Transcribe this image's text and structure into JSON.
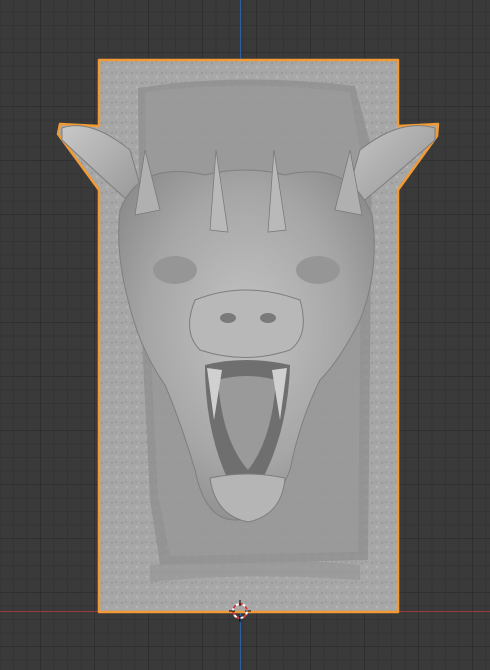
{
  "viewport": {
    "background": "#3a3a3a",
    "grid_color": "#2f2f2f",
    "axis_x_color": "#9a3a3f",
    "axis_y_color": "#2f5f9a"
  },
  "object": {
    "name": "dragon-head-relief",
    "selected": true,
    "outline_color": "#f19a36",
    "surface_color": "#a9a9a9"
  },
  "cursor_3d": {
    "icon": "3d-cursor-icon",
    "ring_colors": [
      "#d63b3b",
      "#ffffff"
    ]
  }
}
